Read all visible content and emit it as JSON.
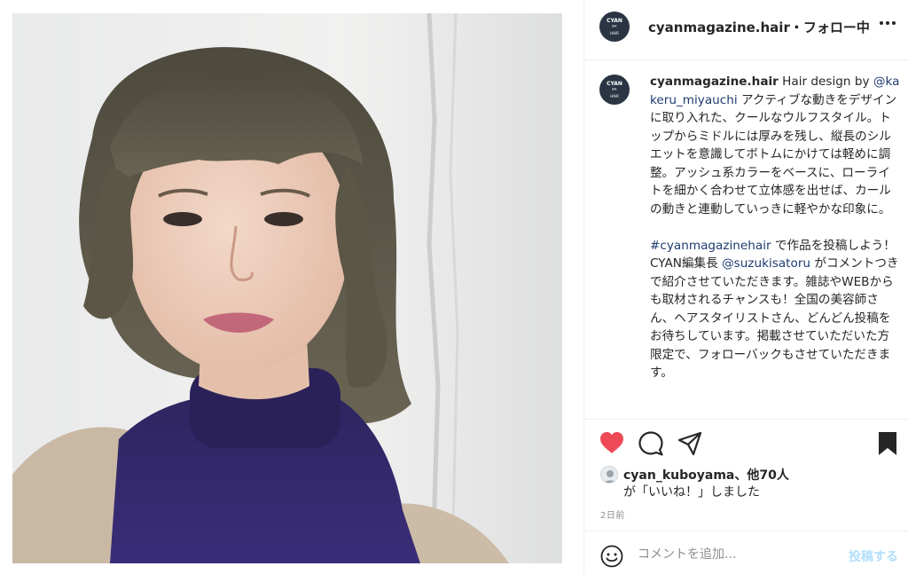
{
  "post": {
    "username": "cyanmagazine.hair",
    "header_separator": "・",
    "follow_status": "フォロー中",
    "more_icon": "more-horizontal-icon",
    "avatar_text": "CYAN",
    "avatar_subtext": "HAIR"
  },
  "caption": {
    "username": "cyanmagazine.hair",
    "intro": " Hair design by ",
    "mention_designer": "@kakeru_miyauchi",
    "paragraph1": "アクティブな動きをデザインに取り入れた、クールなウルフスタイル。トップからミドルには厚みを残し、縦長のシルエットを意識してボトムにかけては軽めに調整。アッシュ系カラーをベースに、ローライトを細かく合わせて立体感を出せば、カールの動きと連動していっきに軽やかな印象に。",
    "hashtag": "#cyanmagazinehair",
    "paragraph2_a": " で作品を投稿しよう！CYAN編集長 ",
    "mention_editor": "@suzukisatoru",
    "paragraph2_b": " がコメントつきで紹介させていただきます。雑誌やWEBからも取材されるチャンスも！全国の美容師さん、ヘアスタイリストさん、どんどん投稿をお待ちしています。掲載させていただいた方限定で、フォローバックもさせていただきます。"
  },
  "actions": {
    "liked": true,
    "like_color": "#ed4956",
    "icons": [
      "heart-icon",
      "comment-icon",
      "share-icon",
      "bookmark-icon"
    ]
  },
  "likes": {
    "first_user": "cyan_kuboyama",
    "others": "、他70人",
    "suffix": "が「いいね！」しました"
  },
  "timestamp": "2日前",
  "comment_box": {
    "placeholder": "コメントを追加...",
    "post_label": "投稿する",
    "emoji_icon": "smiley-icon"
  },
  "colors": {
    "link": "#1d3b6f",
    "post_button_disabled": "#b2dffc",
    "border": "#efefef",
    "muted": "#8e8e8e"
  }
}
